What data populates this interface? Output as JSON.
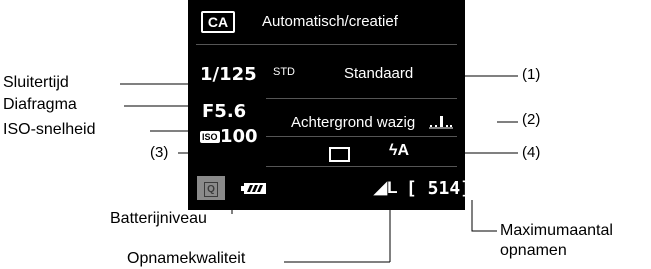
{
  "screen": {
    "mode_badge": "CA",
    "mode_title": "Automatisch/creatief",
    "shutter_speed": "1/125",
    "aperture": "F5.6",
    "iso_icon": "ISO",
    "iso_value": "100",
    "picture_style_icon": "STD",
    "picture_style": "Standaard",
    "background_blur": "Achtergrond wazig",
    "flash_icon": "ϟA",
    "q_button": "Q",
    "quality": "◢L",
    "shots_remaining": "[ 514]"
  },
  "labels": {
    "shutter": "Sluitertijd",
    "aperture": "Diafragma",
    "iso": "ISO-snelheid",
    "battery": "Batterijniveau",
    "quality": "Opnamekwaliteit",
    "max_shots_line1": "Maximumaantal",
    "max_shots_line2": "opnamen"
  },
  "callouts": {
    "c1": "(1)",
    "c2": "(2)",
    "c3": "(3)",
    "c4": "(4)"
  }
}
